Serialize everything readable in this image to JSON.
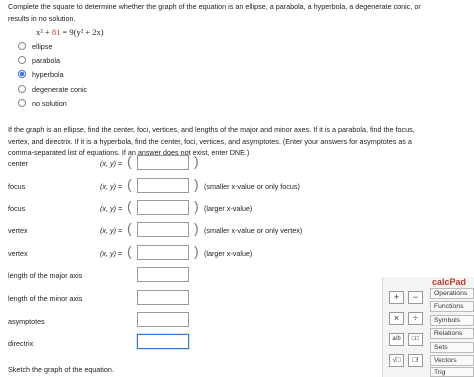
{
  "question": {
    "line1": "Complete the square to determine whether the graph of the equation is an ellipse, a parabola, a hyperbola, a degenerate conic, or",
    "line2": "results in no solution.",
    "equation": {
      "lhs_x2": "x² + ",
      "red": "81",
      "rest": " = 9(y² + 2x)"
    }
  },
  "options": [
    {
      "label": "ellipse",
      "checked": false
    },
    {
      "label": "parabola",
      "checked": false
    },
    {
      "label": "hyperbola",
      "checked": true
    },
    {
      "label": "degenerate conic",
      "checked": false
    },
    {
      "label": "no solution",
      "checked": false
    }
  ],
  "instructions": {
    "line1": "If the graph is an ellipse, find the center, foci, vertices, and lengths of the major and minor axes. If it is a parabola, find the focus,",
    "line2": "vertex, and directrix. If it is a hyperbola, find the center, foci, vertices, and asymptotes. (Enter your answers for asymptotes as a",
    "line3": "comma-separated list of equations. If an answer does not exist, enter DNE.)"
  },
  "fields": {
    "center": {
      "label": "center",
      "xy": "(x, y) =",
      "hint": ""
    },
    "focus1": {
      "label": "focus",
      "xy": "(x, y) =",
      "hint": "(smaller x-value or only focus)"
    },
    "focus2": {
      "label": "focus",
      "xy": "(x, y) =",
      "hint": "(larger x-value)"
    },
    "vertex1": {
      "label": "vertex",
      "xy": "(x, y) =",
      "hint": "(smaller x-value or only vertex)"
    },
    "vertex2": {
      "label": "vertex",
      "xy": "(x, y) =",
      "hint": "(larger x-value)"
    },
    "major": {
      "label": "length of the major axis"
    },
    "minor": {
      "label": "length of the minor axis"
    },
    "asymptotes": {
      "label": "asymptotes"
    },
    "directrix": {
      "label": "directrix"
    }
  },
  "sketch_label": "Sketch the graph of the equation.",
  "calcpad": {
    "title": "calcPad",
    "menu": [
      "Operations",
      "Functions",
      "Symbols",
      "Relations",
      "Sets",
      "Vectors",
      "Trig"
    ],
    "buttons": [
      "+",
      "−",
      "×",
      "÷",
      "a/b",
      "□□",
      "√□",
      "□!"
    ]
  }
}
